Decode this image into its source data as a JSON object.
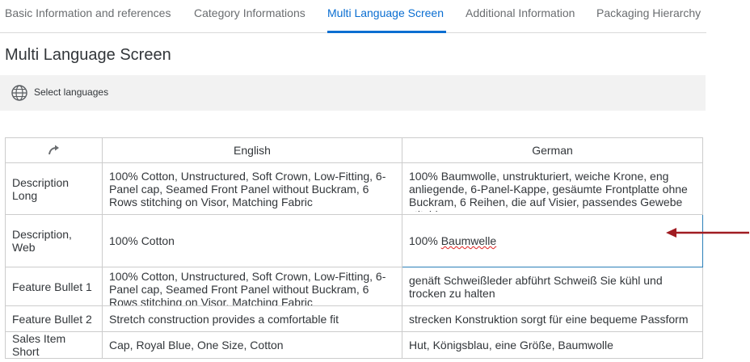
{
  "tabs": [
    {
      "label": "Basic Information and references"
    },
    {
      "label": "Category Informations"
    },
    {
      "label": "Multi Language Screen"
    },
    {
      "label": "Additional Information"
    },
    {
      "label": "Packaging Hierarchy"
    }
  ],
  "page_title": "Multi Language Screen",
  "language_bar": {
    "label": "Select languages",
    "icon": "globe-icon"
  },
  "table": {
    "header_icon": "sort-swap-icon",
    "columns": [
      "English",
      "German"
    ],
    "rows": [
      {
        "label": "Description Long",
        "english": "100% Cotton, Unstructured, Soft Crown, Low-Fitting, 6-Panel cap, Seamed Front Panel without Buckram, 6 Rows stitching on Visor, Matching Fabric",
        "german": "100% Baumwolle, unstrukturiert, weiche Krone, eng anliegende, 6-Panel-Kappe, gesäumte Frontplatte ohne Buckram, 6 Reihen, die auf Visier, passendes Gewebe stitching"
      },
      {
        "label": "Description, Web",
        "english": "100% Cotton",
        "german_prefix": "100% ",
        "german_misspelled": "Baumwelle"
      },
      {
        "label": "Feature Bullet 1",
        "english": "100% Cotton, Unstructured, Soft Crown, Low-Fitting, 6-Panel cap, Seamed Front Panel without Buckram, 6 Rows stitching on Visor, Matching Fabric",
        "german": "genäft Schweißleder abführt Schweiß Sie kühl und trocken zu halten"
      },
      {
        "label": "Feature Bullet 2",
        "english": "Stretch construction provides a comfortable fit",
        "german": "strecken Konstruktion sorgt für eine bequeme Passform"
      },
      {
        "label": "Sales Item Short",
        "english": "Cap, Royal Blue, One Size, Cotton",
        "german": "Hut, Königsblau, eine Größe, Baumwolle"
      }
    ]
  },
  "colors": {
    "accent": "#0a6ed1",
    "annotation_arrow": "#a01c22",
    "edit_border": "#2b7fb8"
  }
}
